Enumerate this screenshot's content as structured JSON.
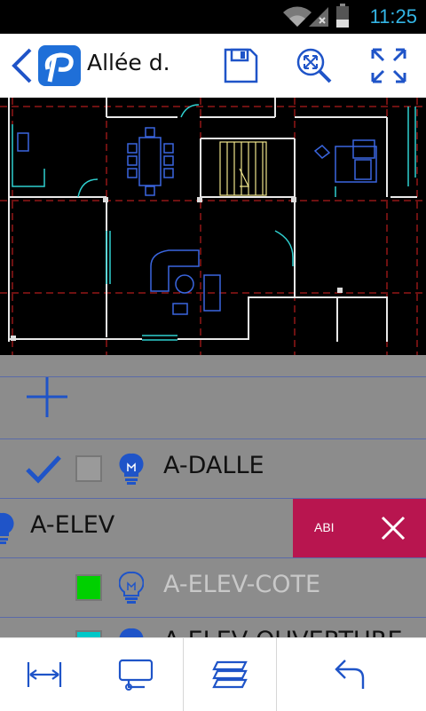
{
  "status": {
    "time": "11:25"
  },
  "header": {
    "title": "Allée d."
  },
  "layers": [
    {
      "name": "A-DALLE",
      "color": "#9a9a9a",
      "visible": true,
      "checked": true
    },
    {
      "name": "A-ELEV",
      "visible": true
    },
    {
      "name": "A-ELEV-COTE",
      "color": "#00d000",
      "visible": false
    },
    {
      "name": "A-ELEV-OUVERTURE",
      "color": "#00c8c8",
      "visible": true
    }
  ],
  "swipe_action": {
    "label": "ABI"
  },
  "colors": {
    "accent": "#1f54c8",
    "status": "#33b5e5",
    "delete": "#b8154f"
  }
}
